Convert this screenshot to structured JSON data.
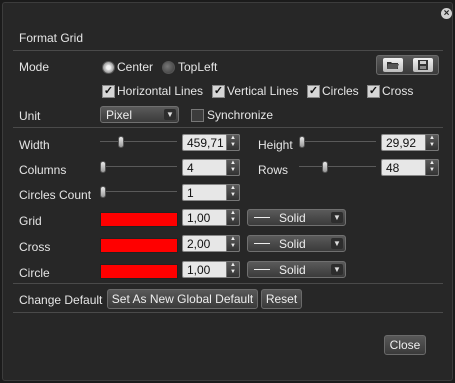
{
  "dialog": {
    "title": "Format Grid"
  },
  "mode": {
    "label": "Mode",
    "options": [
      "Center",
      "TopLeft"
    ],
    "selected": "Center"
  },
  "toggles": {
    "horizontal_lines": "Horizontal Lines",
    "vertical_lines": "Vertical Lines",
    "circles": "Circles",
    "cross": "Cross"
  },
  "unit": {
    "label": "Unit",
    "value": "Pixel",
    "synchronize_label": "Synchronize"
  },
  "dimensions": {
    "width_label": "Width",
    "width_value": "459,71",
    "height_label": "Height",
    "height_value": "29,92",
    "columns_label": "Columns",
    "columns_value": "4",
    "rows_label": "Rows",
    "rows_value": "48",
    "circles_count_label": "Circles Count",
    "circles_count_value": "1"
  },
  "styles": {
    "grid": {
      "label": "Grid",
      "color": "#ff0000",
      "width": "1,00",
      "line": "Solid"
    },
    "cross": {
      "label": "Cross",
      "color": "#ff0000",
      "width": "2,00",
      "line": "Solid"
    },
    "circle": {
      "label": "Circle",
      "color": "#ff0000",
      "width": "1,00",
      "line": "Solid"
    }
  },
  "defaults": {
    "label": "Change Default",
    "set_global": "Set As New Global Default",
    "reset": "Reset"
  },
  "footer": {
    "close": "Close"
  },
  "icons": {
    "open": "folder-open-icon",
    "save": "floppy-disk-icon",
    "dialog_close": "close-icon"
  }
}
